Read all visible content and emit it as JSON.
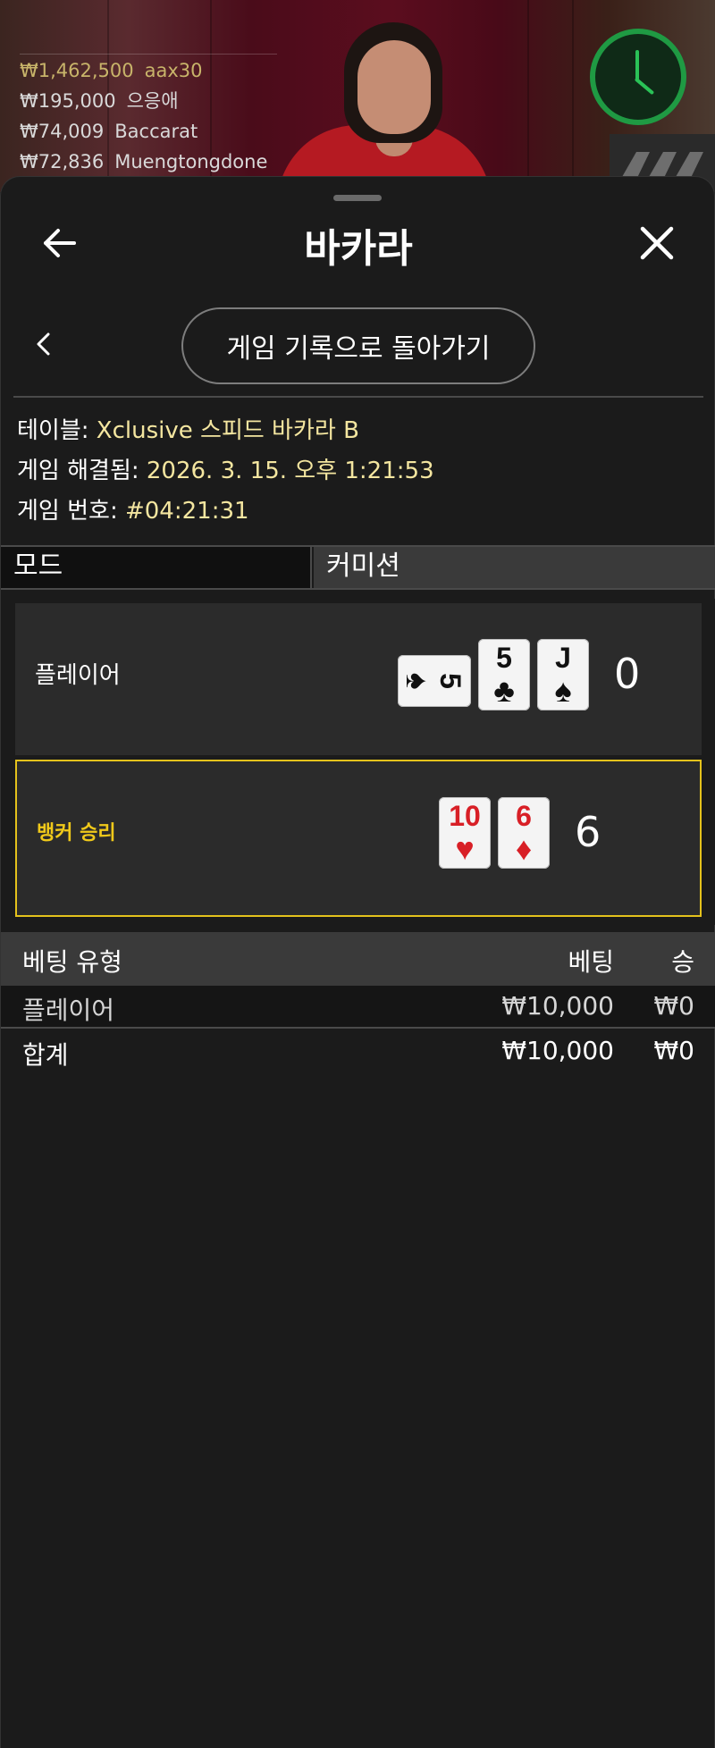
{
  "leaderboard": [
    {
      "amount": "₩1,462,500",
      "name": "aax30"
    },
    {
      "amount": "₩195,000",
      "name": "으응애"
    },
    {
      "amount": "₩74,009",
      "name": "Baccarat"
    },
    {
      "amount": "₩72,836",
      "name": "Muengtongdone"
    }
  ],
  "header": {
    "title": "바카라",
    "back_icon": "arrow-left-icon",
    "close_icon": "close-icon"
  },
  "nav": {
    "return_label": "게임 기록으로 돌아가기"
  },
  "info": {
    "table_label": "테이블:",
    "table_value": "Xclusive 스피드 바카라 B",
    "resolved_label": "게임 해결됨:",
    "resolved_value": "2026. 3. 15. 오후 1:21:53",
    "number_label": "게임 번호:",
    "number_value": "#04:21:31"
  },
  "mode": {
    "label": "모드",
    "value": "커미션"
  },
  "result": {
    "player": {
      "label": "플레이어",
      "score": "0",
      "cards": [
        {
          "rank": "5",
          "suit": "♠",
          "color": "#111111",
          "rotated": true
        },
        {
          "rank": "5",
          "suit": "♣",
          "color": "#111111",
          "rotated": false
        },
        {
          "rank": "J",
          "suit": "♠",
          "color": "#111111",
          "rotated": false
        }
      ]
    },
    "banker": {
      "label": "뱅커 승리",
      "score": "6",
      "cards": [
        {
          "rank": "10",
          "suit": "♥",
          "color": "#d81f26",
          "rotated": false
        },
        {
          "rank": "6",
          "suit": "♦",
          "color": "#d81f26",
          "rotated": false
        }
      ]
    },
    "win_color": "#e4c21c"
  },
  "bets": {
    "headers": {
      "type": "베팅 유형",
      "bet": "베팅",
      "win": "승"
    },
    "rows": [
      {
        "type": "플레이어",
        "bet": "₩10,000",
        "win": "₩0"
      }
    ],
    "total": {
      "type": "합계",
      "bet": "₩10,000",
      "win": "₩0"
    }
  }
}
